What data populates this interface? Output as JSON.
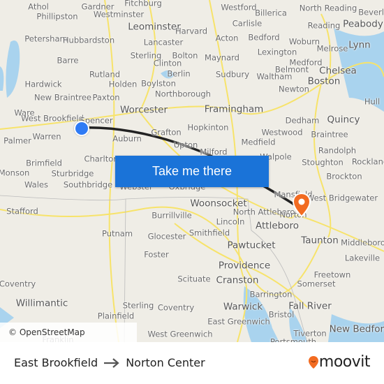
{
  "map": {
    "places": [
      "Athol",
      "Gardner",
      "Fitchburg",
      "Westford",
      "Billerica",
      "North Reading",
      "Beverly",
      "Phillipston",
      "Westminster",
      "Leominster",
      "Harvard",
      "Carlisle",
      "Reading",
      "Peabody",
      "Petersham",
      "Hubbardston",
      "Lancaster",
      "Acton",
      "Bedford",
      "Woburn",
      "Lynn",
      "Barre",
      "Sterling",
      "Bolton",
      "Clinton",
      "Maynard",
      "Lexington",
      "Melrose",
      "Medford",
      "Rutland",
      "Berlin",
      "Sudbury",
      "Waltham",
      "Belmont",
      "Chelsea",
      "Holden",
      "Boylston",
      "Boston",
      "Hardwick",
      "New Braintree",
      "Paxton",
      "Northborough",
      "Newton",
      "Hull",
      "Worcester",
      "Framingham",
      "Ware",
      "West Brookfield",
      "Spencer",
      "Dedham",
      "Quincy",
      "Hopkinton",
      "Grafton",
      "Westwood",
      "Braintree",
      "Palmer",
      "Warren",
      "Auburn",
      "Medfield",
      "Randolph",
      "Upton",
      "Milford",
      "Walpole",
      "Stoughton",
      "Rockland",
      "Brimfield",
      "Charlton",
      "Monson",
      "Sturbridge",
      "Brockton",
      "Mansfield",
      "Wales",
      "Southbridge",
      "Webster",
      "Oxbridge",
      "West Bridgewater",
      "Woonsocket",
      "North Attleboro",
      "Attleboro",
      "Norton",
      "Stafford",
      "Burrillville",
      "Smithfield",
      "Lincoln",
      "Putnam",
      "Glocester",
      "Pawtucket",
      "Taunton",
      "Middleboro",
      "Foster",
      "Lakeville",
      "Providence",
      "Freetown",
      "Scituate",
      "Cranston",
      "Somerset",
      "Coventry",
      "Barrington",
      "Willimantic",
      "Sterling",
      "Coventry",
      "Warwick",
      "Fall River",
      "Plainfield",
      "East Greenwich",
      "Bristol",
      "West Greenwich",
      "Tiverton",
      "New Bedford",
      "Franklin",
      "Portsmouth"
    ],
    "attribution": "© OpenStreetMap contributors",
    "cta_label": "Take me there",
    "route_color": "#222222",
    "origin_color": "#2f7bf5",
    "destination_color": "#f26b21",
    "button_color": "#1a73d8"
  },
  "footer": {
    "origin": "East Brookfield",
    "arrow_icon": "arrow-right-icon",
    "destination": "Norton Center",
    "brand": "moovit",
    "brand_color": "#f26b21"
  }
}
